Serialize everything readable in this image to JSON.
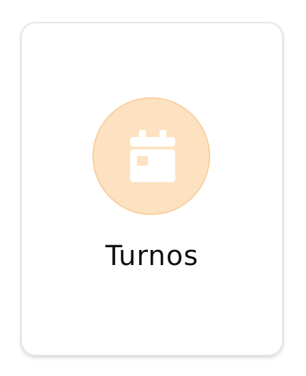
{
  "card": {
    "title": "Turnos",
    "icon": "calendar-icon",
    "colors": {
      "circle_fill": "#fde2c1",
      "circle_border": "#f9cf9e",
      "icon_fill": "#ffffff",
      "title_text": "#111111"
    }
  }
}
